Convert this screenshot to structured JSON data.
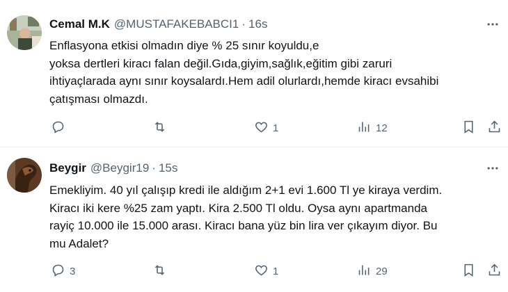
{
  "tweets": [
    {
      "name": "Cemal M.K",
      "handle": "@MUSTAFAKEBABCI1",
      "separator": "·",
      "time": "16s",
      "text_lines": [
        "Enflasyona etkisi olmadın diye  % 25 sınır koyuldu,e",
        "yoksa dertleri kiracı falan değil.Gıda,giyim,sağlık,eğitim gibi zaruri",
        "ihtiyaçlarada aynı sınır koysalardı.Hem adil olurlardı,hemde kiracı evsahibi",
        "çatışması olmazdı."
      ],
      "reply_count": "",
      "retweet_count": "",
      "like_count": "1",
      "view_count": "12",
      "icons": {
        "reply": "reply-icon",
        "retweet": "retweet-icon",
        "like": "heart-icon",
        "views": "bar-chart-icon",
        "bookmark": "bookmark-icon",
        "share": "share-icon",
        "more": "more-icon"
      }
    },
    {
      "name": "Beygir",
      "handle": "@Beygir19",
      "separator": "·",
      "time": "15s",
      "text_lines": [
        "Emekliyim. 40 yıl çalışıp kredi ile aldığım 2+1 evi 1.600 Tl ye kiraya verdim.",
        "Kiracı iki kere %25 zam yaptı. Kira 2.500 Tl oldu. Oysa aynı apartmanda",
        "rayiç 10.000 ile 15.000 arası. Kiracı bana yüz bin lira ver çıkayım diyor. Bu",
        "mu Adalet?"
      ],
      "reply_count": "3",
      "retweet_count": "",
      "like_count": "1",
      "view_count": "29",
      "icons": {
        "reply": "reply-icon",
        "retweet": "retweet-icon",
        "like": "heart-icon",
        "views": "bar-chart-icon",
        "bookmark": "bookmark-icon",
        "share": "share-icon",
        "more": "more-icon"
      }
    }
  ],
  "colors": {
    "text": "#0f1419",
    "secondary": "#536471",
    "divider": "#eff3f4"
  }
}
